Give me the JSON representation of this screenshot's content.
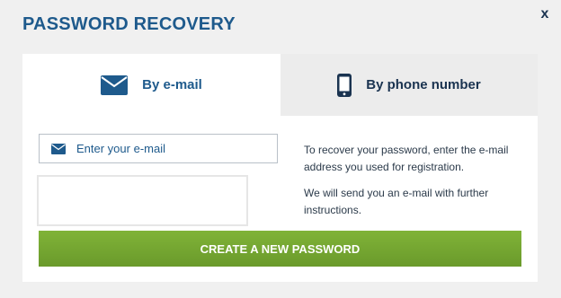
{
  "modal": {
    "title": "PASSWORD RECOVERY",
    "close_label": "x"
  },
  "tabs": [
    {
      "label": "By e-mail",
      "icon": "envelope-icon",
      "active": true
    },
    {
      "label": "By phone number",
      "icon": "mobile-phone-icon",
      "active": false
    }
  ],
  "email_field": {
    "placeholder": "Enter your e-mail",
    "value": "",
    "icon": "envelope-icon"
  },
  "info": {
    "paragraph1": "To recover your password, enter the e-mail address you used for registration.",
    "paragraph2": "We will send you an e-mail with further instructions."
  },
  "submit": {
    "label": "CREATE A NEW PASSWORD"
  },
  "colors": {
    "accent": "#1e5a8c",
    "button_green": "#77a933",
    "background": "#f0f0f0"
  }
}
